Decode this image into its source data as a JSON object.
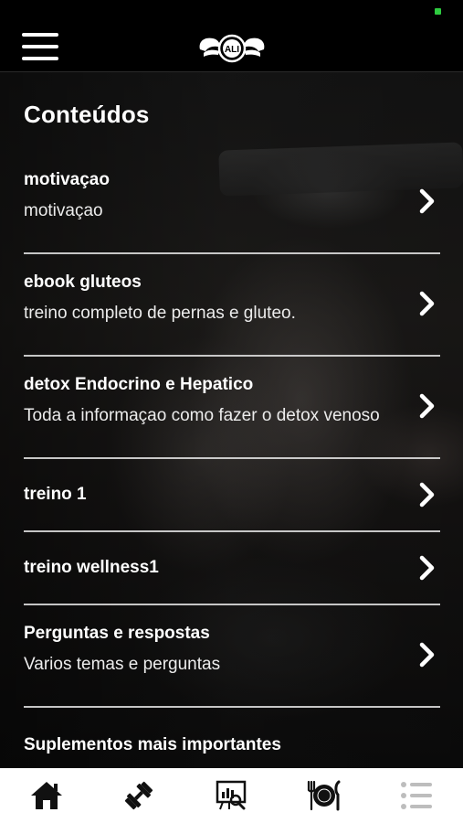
{
  "header": {
    "logo_text": "ALI",
    "status_indicator_color": "#2ecc40"
  },
  "main": {
    "title": "Conteúdos",
    "items": [
      {
        "title": "motivaçao",
        "subtitle": "motivaçao"
      },
      {
        "title": "ebook gluteos",
        "subtitle": "treino completo de pernas e gluteo."
      },
      {
        "title": "detox Endocrino e Hepatico",
        "subtitle": "Toda a informaçao como fazer o detox venoso"
      },
      {
        "title": "treino 1",
        "subtitle": ""
      },
      {
        "title": "treino wellness1",
        "subtitle": ""
      },
      {
        "title": "Perguntas e respostas",
        "subtitle": "Varios temas e perguntas"
      },
      {
        "title": "Suplementos mais importantes",
        "subtitle": ""
      }
    ]
  },
  "bottom_nav": {
    "items": [
      {
        "icon": "home-icon",
        "active": false
      },
      {
        "icon": "dumbbell-icon",
        "active": false
      },
      {
        "icon": "analytics-board-icon",
        "active": false
      },
      {
        "icon": "meal-plate-icon",
        "active": false
      },
      {
        "icon": "list-icon",
        "active": true
      }
    ],
    "active_color": "#bdbdbd",
    "icon_color": "#111111"
  }
}
